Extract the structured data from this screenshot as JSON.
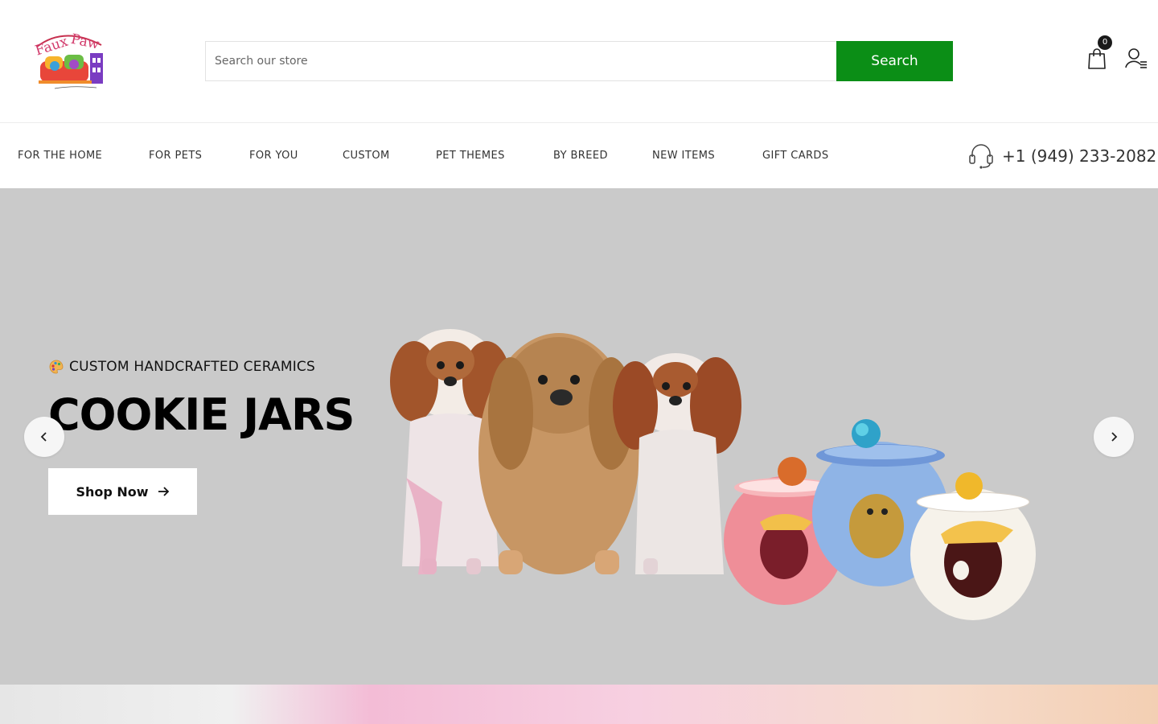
{
  "brand": {
    "logo_alt": "Faux Paw"
  },
  "search": {
    "placeholder": "Search our store",
    "button_label": "Search"
  },
  "cart": {
    "count": "0"
  },
  "nav": {
    "items": [
      {
        "label": "FOR THE HOME"
      },
      {
        "label": "FOR PETS"
      },
      {
        "label": "FOR YOU"
      },
      {
        "label": "CUSTOM"
      },
      {
        "label": "PET THEMES"
      },
      {
        "label": "BY BREED"
      },
      {
        "label": "NEW ITEMS"
      },
      {
        "label": "GIFT CARDS"
      }
    ],
    "phone": "+1 (949) 233-2082"
  },
  "hero": {
    "eyebrow": "CUSTOM HANDCRAFTED CERAMICS",
    "title": "COOKIE JARS",
    "cta_label": "Shop Now"
  },
  "colors": {
    "accent": "#0b8e16",
    "hero_bg": "#cacaca"
  }
}
